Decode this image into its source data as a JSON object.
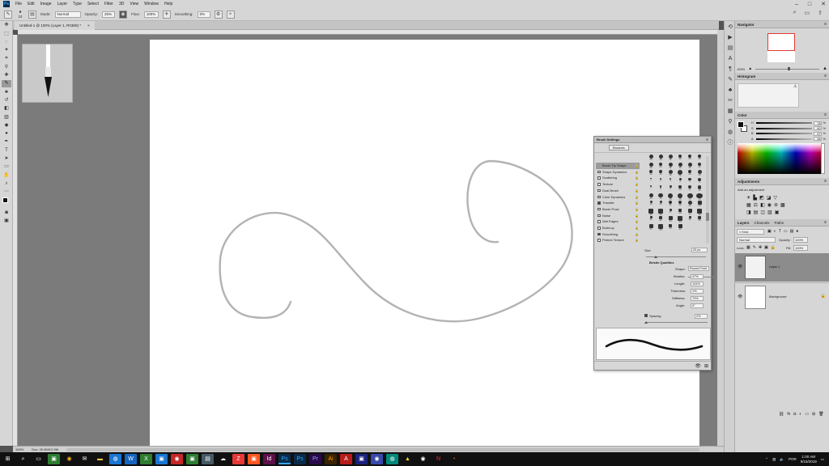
{
  "app": {
    "logo": "Ps",
    "menu": [
      "File",
      "Edit",
      "Image",
      "Layer",
      "Type",
      "Select",
      "Filter",
      "3D",
      "View",
      "Window",
      "Help"
    ]
  },
  "options_bar": {
    "brush_size": "24",
    "mode_label": "Mode:",
    "mode_value": "Normal",
    "opacity_label": "Opacity:",
    "opacity_value": "25%",
    "flow_label": "Flow:",
    "flow_value": "100%",
    "smoothing_label": "Smoothing:",
    "smoothing_value": "0%"
  },
  "document": {
    "tab_title": "Untitled-1 @ 100% (Layer 1, RGB/8) *",
    "tab_close": "×",
    "zoom": "100%",
    "doc_info": "Doc: 29.9M/12.9M"
  },
  "brush_settings": {
    "title": "Brush Settings",
    "brushes_button": "Brushes",
    "options": [
      {
        "label": "Brush Tip Shape",
        "checkbox": false,
        "selected": true
      },
      {
        "label": "Shape Dynamics",
        "checkbox": true,
        "checked": false
      },
      {
        "label": "Scattering",
        "checkbox": true,
        "checked": false
      },
      {
        "label": "Texture",
        "checkbox": true,
        "checked": false
      },
      {
        "label": "Dual Brush",
        "checkbox": true,
        "checked": false
      },
      {
        "label": "Color Dynamics",
        "checkbox": true,
        "checked": false
      },
      {
        "label": "Transfer",
        "checkbox": true,
        "checked": true
      },
      {
        "label": "Brush Pose",
        "checkbox": true,
        "checked": false
      },
      {
        "label": "Noise",
        "checkbox": true,
        "checked": false
      },
      {
        "label": "Wet Edges",
        "checkbox": true,
        "checked": false
      },
      {
        "label": "Build-up",
        "checkbox": true,
        "checked": false
      },
      {
        "label": "Smoothing",
        "checkbox": true,
        "checked": true
      },
      {
        "label": "Protect Texture",
        "checkbox": true,
        "checked": false
      }
    ],
    "tip_numbers": [
      "30",
      "30",
      "30",
      "25",
      "25",
      "25",
      "36",
      "25",
      "36",
      "36",
      "36",
      "32",
      "32",
      "25",
      "50",
      "71",
      "25",
      "50",
      "1",
      "2",
      "3",
      "4",
      "5",
      "6",
      "7",
      "8",
      "9",
      "10",
      "11",
      "12",
      "13",
      "14",
      "15",
      "16",
      "17",
      "18",
      "19",
      "20",
      "21",
      "22",
      "23",
      "24",
      "25",
      "26",
      "27",
      "28",
      "29",
      "30",
      "31",
      "32",
      "33",
      "34",
      "35",
      "36",
      "37",
      "38",
      "39",
      "40"
    ],
    "size_label": "Size",
    "size_value": "20 px",
    "bristle_title": "Bristle Qualities",
    "shape_label": "Shape:",
    "shape_value": "Round Point",
    "bristles_label": "Bristles:",
    "bristles_value": "47%",
    "length_label": "Length:",
    "length_value": "141%",
    "thickness_label": "Thickness:",
    "thickness_value": "1%",
    "stiffness_label": "Stiffness:",
    "stiffness_value": "74%",
    "angle_label": "Angle:",
    "angle_value": "0°",
    "spacing_label": "Spacing",
    "spacing_value": "2%"
  },
  "navigator": {
    "title": "Navigator",
    "zoom": "100%"
  },
  "histogram": {
    "title": "Histogram"
  },
  "color": {
    "title": "Color",
    "channels": [
      {
        "label": "H",
        "value": "78"
      },
      {
        "label": "S",
        "value": "60"
      },
      {
        "label": "B",
        "value": "57"
      },
      {
        "label": "A",
        "value": "96"
      }
    ],
    "percent": "%"
  },
  "adjustments": {
    "title": "Adjustments",
    "subtitle": "Add an adjustment"
  },
  "layers": {
    "tabs": [
      "Layers",
      "Channels",
      "Paths"
    ],
    "kind_value": "Kind",
    "blend_value": "Normal",
    "opacity_label": "Opacity:",
    "opacity_value": "100%",
    "lock_label": "Lock:",
    "fill_label": "Fill:",
    "fill_value": "100%",
    "items": [
      {
        "name": "Layer 1",
        "selected": true
      },
      {
        "name": "Background",
        "selected": false
      }
    ]
  },
  "taskbar": {
    "lang": "POR",
    "time": "1:00 AM",
    "date": "9/15/2019"
  },
  "colors": {
    "accent_red": "#e53935",
    "stroke": "#b3b3b3"
  }
}
